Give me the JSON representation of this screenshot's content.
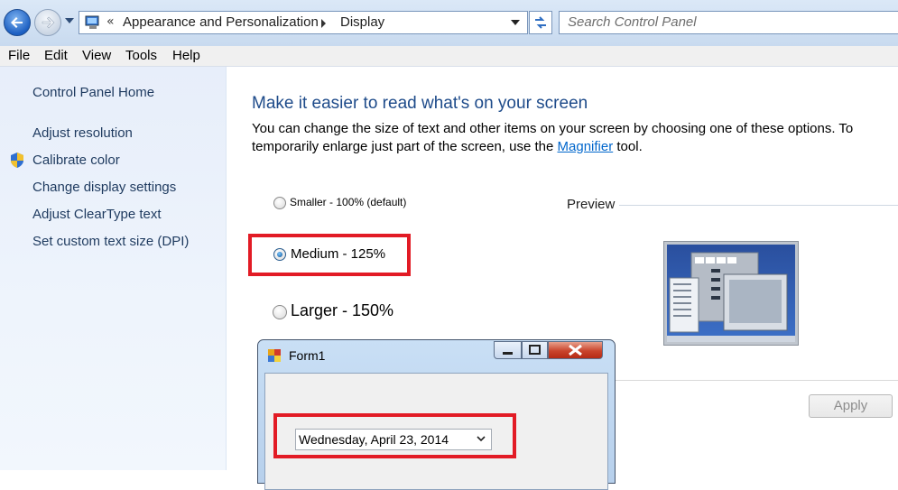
{
  "addressbar": {
    "breadcrumb_chevron": "«",
    "crumb1": "Appearance and Personalization",
    "crumb2": "Display",
    "search_placeholder": "Search Control Panel"
  },
  "menu": [
    "File",
    "Edit",
    "View",
    "Tools",
    "Help"
  ],
  "sidebar": {
    "home": "Control Panel Home",
    "links": [
      "Adjust resolution",
      "Calibrate color",
      "Change display settings",
      "Adjust ClearType text",
      "Set custom text size (DPI)"
    ]
  },
  "main": {
    "title": "Make it easier to read what's on your screen",
    "desc_before": "You can change the size of text and other items on your screen by choosing one of these options. To temporarily enlarge just part of the screen, use the ",
    "desc_link": "Magnifier",
    "desc_after": " tool.",
    "options": [
      {
        "label": "Smaller - 100% (default)",
        "checked": false
      },
      {
        "label": "Medium - 125%",
        "checked": true
      },
      {
        "label": "Larger - 150%",
        "checked": false
      }
    ],
    "preview_label": "Preview",
    "apply_label": "Apply"
  },
  "form1": {
    "title": "Form1",
    "date_value": "Wednesday, April 23, 2014"
  },
  "colors": {
    "highlight_box": "#e21b25",
    "link": "#0066cc",
    "title_blue": "#1e4b8a"
  }
}
